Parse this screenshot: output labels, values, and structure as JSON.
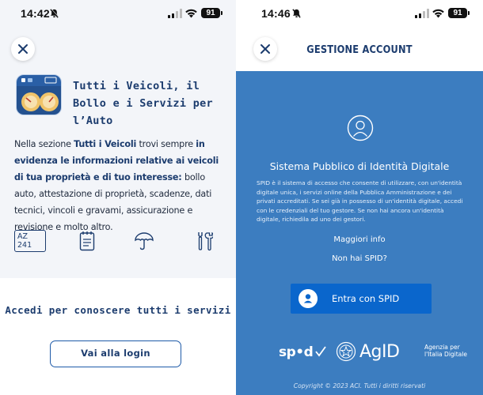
{
  "left_screen": {
    "status_bar": {
      "time": "14:42",
      "battery": "91"
    },
    "vehicle": {
      "title": "Tutti i Veicoli, il Bollo e i Servizi per l’Auto"
    },
    "description": {
      "p1": "Nella sezione ",
      "b1": "Tutti i Veicoli",
      "p2": " trovi sempre ",
      "b2": "in evidenza le informazioni relative ai veicoli di tua proprietà e di tuo interesse:",
      "p3": " bollo auto, attestazione di proprietà, scadenze, dati tecnici, vincoli e gravami, assicurazione e revisione e molto altro."
    },
    "features": {
      "plate_text": "AZ 241"
    },
    "login": {
      "heading": "Accedi per conoscere tutti i servizi",
      "button_label": "Vai alla login"
    }
  },
  "right_screen": {
    "status_bar": {
      "time": "14:46",
      "battery": "91"
    },
    "header_title": "GESTIONE ACCOUNT",
    "spid": {
      "title": "Sistema Pubblico di Identità Digitale",
      "body": "SPID è il sistema di accesso che consente di utilizzare, con un'identità digitale unica, i servizi online della Pubblica Amministrazione e dei privati accreditati. Se sei già in possesso di un'identità digitale, accedi con le credenziali del tuo gestore. Se non hai ancora un'identità digitale, richiedila ad uno dei gestori.",
      "more_info": "Maggiori info",
      "no_spid": "Non hai SPID?",
      "button_label": "Entra con SPID"
    },
    "logos": {
      "spid": "sp•d",
      "agid": "AgID",
      "agid_subtitle_1": "Agenzia per",
      "agid_subtitle_2": "l'Italia Digitale"
    },
    "copyright": "Copyright © 2023 ACI. Tutti i diritti riservati"
  },
  "colors": {
    "primary_text": "#1c3c6e",
    "spid_panel": "#3c7dc0",
    "spid_button": "#0a66cc",
    "left_background": "#f3f5f9"
  }
}
